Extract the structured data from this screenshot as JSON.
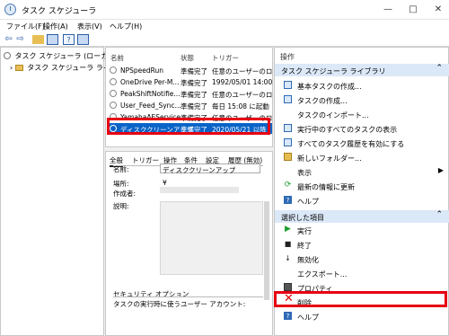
{
  "window": {
    "title": "タスク スケジューラ",
    "minimize_icon": "minimize-icon",
    "maximize_icon": "maximize-icon",
    "close_icon": "close-icon"
  },
  "menu": [
    "ファイル(F)",
    "操作(A)",
    "表示(V)",
    "ヘルプ(H)"
  ],
  "tree": {
    "root": "タスク スケジューラ (ローカル)",
    "library": "タスク スケジューラ ライブラリ"
  },
  "task_columns": [
    "名前",
    "状態",
    "トリガー"
  ],
  "tasks": [
    {
      "name": "NPSpeedRun",
      "status": "準備完了",
      "trigger": "任意のユーザーのロ"
    },
    {
      "name": "OneDrive Per-M...",
      "status": "準備完了",
      "trigger": "1992/05/01 14:00"
    },
    {
      "name": "PeakShiftNotifie...",
      "status": "準備完了",
      "trigger": "任意のユーザーのロ"
    },
    {
      "name": "User_Feed_Sync...",
      "status": "準備完了",
      "trigger": "毎日 15:08 に起動"
    },
    {
      "name": "YamahaAEService",
      "status": "準備完了",
      "trigger": "任意のユーザーのロ"
    },
    {
      "name": "ディスククリーンアップ",
      "status": "準備完了",
      "trigger": "2020/05/21 以降"
    }
  ],
  "detail_tabs": [
    "全般",
    "トリガー",
    "操作",
    "条件",
    "設定",
    "履歴 (無効)"
  ],
  "details": {
    "name_label": "名前:",
    "name_value": "ディスククリーンアップ",
    "location_label": "場所:",
    "location_value": "¥",
    "author_label": "作成者:",
    "description_label": "説明:",
    "security_section": "セキュリティ オプション",
    "security_text": "タスクの実行時に使うユーザー アカウント:"
  },
  "actions_pane": {
    "title": "操作",
    "library_section": "タスク スケジューラ ライブラリ",
    "library_items": [
      {
        "label": "基本タスクの作成...",
        "icon": "basic-task-icon"
      },
      {
        "label": "タスクの作成...",
        "icon": "create-task-icon"
      },
      {
        "label": "タスクのインポート...",
        "icon": "import-icon"
      },
      {
        "label": "実行中のすべてのタスクの表示",
        "icon": "running-tasks-icon"
      },
      {
        "label": "すべてのタスク履歴を有効にする",
        "icon": "history-icon"
      },
      {
        "label": "新しいフォルダー...",
        "icon": "new-folder-icon"
      },
      {
        "label": "表示",
        "icon": "view-icon",
        "submenu": "chevron-right-icon"
      },
      {
        "label": "最新の情報に更新",
        "icon": "refresh-icon"
      },
      {
        "label": "ヘルプ",
        "icon": "help-icon"
      }
    ],
    "selected_section": "選択した項目",
    "selected_items": [
      {
        "label": "実行",
        "icon": "run-icon"
      },
      {
        "label": "終了",
        "icon": "stop-icon"
      },
      {
        "label": "無効化",
        "icon": "disable-icon"
      },
      {
        "label": "エクスポート...",
        "icon": "export-icon"
      },
      {
        "label": "プロパティ",
        "icon": "properties-icon"
      },
      {
        "label": "削除",
        "icon": "delete-icon"
      },
      {
        "label": "ヘルプ",
        "icon": "help-icon"
      }
    ]
  },
  "highlight_color": "#e60012",
  "selection_color": "#0a64c8"
}
